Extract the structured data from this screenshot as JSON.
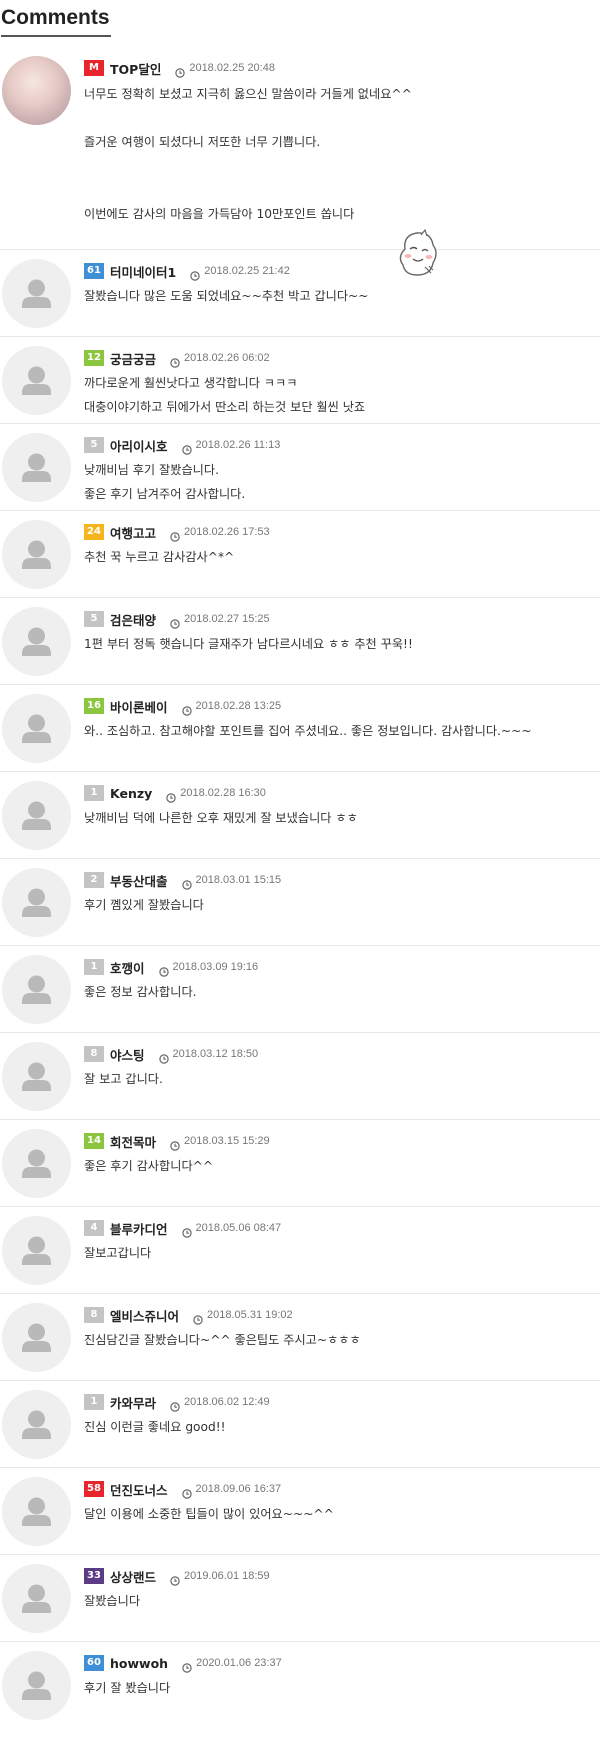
{
  "section_title": "Comments",
  "colors": {
    "M": "#e8252d",
    "blue": "#3f8fd6",
    "green": "#8cc63f",
    "gray": "#c4c4c4",
    "yellow": "#f5b51b",
    "red": "#e8252d",
    "purple": "#5b3a86"
  },
  "comments": [
    {
      "level": "M",
      "level_color": "M",
      "nick": "TOP달인",
      "date": "2018.02.25 20:48",
      "avatar": "photo",
      "lines": [
        "너무도 정확히 보셨고 지극히 옳으신 말씀이라 거들게 없네요^^",
        "",
        "즐거운 여행이 되셨다니 저또한 너무 기쁩니다.",
        "",
        "",
        "이번에도 감사의 마음을 가득담아 10만포인트 쏩니다"
      ]
    },
    {
      "level": "61",
      "level_color": "blue",
      "nick": "터미네이터1",
      "date": "2018.02.25 21:42",
      "lines": [
        "잘봤습니다 많은 도움 되었네요~~추천 박고 갑니다~~"
      ]
    },
    {
      "level": "12",
      "level_color": "green",
      "nick": "궁금궁금",
      "date": "2018.02.26 06:02",
      "lines": [
        "까다로운게 훨씬낫다고 생각합니다 ㅋㅋㅋ",
        "대충이야기하고 뒤에가서 딴소리 하는것 보단 훨씬 낫죠"
      ]
    },
    {
      "level": "5",
      "level_color": "gray",
      "nick": "아리이시호",
      "date": "2018.02.26 11:13",
      "lines": [
        "낮깨비님 후기 잘봤습니다.",
        "좋은 후기 남겨주어 감사합니다."
      ]
    },
    {
      "level": "24",
      "level_color": "yellow",
      "nick": "여행고고",
      "date": "2018.02.26 17:53",
      "lines": [
        "추천 꾹 누르고 감사감사^*^"
      ]
    },
    {
      "level": "5",
      "level_color": "gray",
      "nick": "검은태양",
      "date": "2018.02.27 15:25",
      "lines": [
        "1편 부터 정독 햇습니다 글재주가 남다르시네요 ㅎㅎ 추천 꾸욱!!"
      ]
    },
    {
      "level": "16",
      "level_color": "green",
      "nick": "바이론베이",
      "date": "2018.02.28 13:25",
      "lines": [
        "와.. 조심하고. 참고해야할 포인트를 집어 주셨네요.. 좋은 정보입니다. 감사합니다.~~~"
      ]
    },
    {
      "level": "1",
      "level_color": "gray",
      "nick": "Kenzy",
      "date": "2018.02.28 16:30",
      "lines": [
        "낮깨비님 덕에 나른한 오후 재밌게 잘 보냈습니다 ㅎㅎ"
      ]
    },
    {
      "level": "2",
      "level_color": "gray",
      "nick": "부동산대출",
      "date": "2018.03.01 15:15",
      "lines": [
        "후기 꼠있게 잘봤습니다"
      ]
    },
    {
      "level": "1",
      "level_color": "gray",
      "nick": "호깽이",
      "date": "2018.03.09 19:16",
      "lines": [
        "좋은 정보 감사합니다."
      ]
    },
    {
      "level": "8",
      "level_color": "gray",
      "nick": "야스팅",
      "date": "2018.03.12 18:50",
      "lines": [
        "잘 보고   갑니다."
      ]
    },
    {
      "level": "14",
      "level_color": "green",
      "nick": "회전목마",
      "date": "2018.03.15 15:29",
      "lines": [
        "좋은 후기 감사합니다^^"
      ]
    },
    {
      "level": "4",
      "level_color": "gray",
      "nick": "블루카디언",
      "date": "2018.05.06 08:47",
      "lines": [
        "잘보고갑니다"
      ]
    },
    {
      "level": "8",
      "level_color": "gray",
      "nick": "엘비스쥬니어",
      "date": "2018.05.31 19:02",
      "lines": [
        "진심담긴글 잘봤습니다~^^ 좋은팁도 주시고~ㅎㅎㅎ"
      ]
    },
    {
      "level": "1",
      "level_color": "gray",
      "nick": "카와무라",
      "date": "2018.06.02 12:49",
      "lines": [
        "진심 이런글 좋네요 good!!"
      ]
    },
    {
      "level": "58",
      "level_color": "red",
      "nick": "던진도너스",
      "date": "2018.09.06 16:37",
      "lines": [
        "달인 이용에 소중한 팁들이 많이 있어요~~~^^"
      ]
    },
    {
      "level": "33",
      "level_color": "purple",
      "nick": "상상랜드",
      "date": "2019.06.01 18:59",
      "lines": [
        "잘봤습니다"
      ]
    },
    {
      "level": "60",
      "level_color": "blue",
      "nick": "howwoh",
      "date": "2020.01.06 23:37",
      "lines": [
        "후기 잘 봤습니다"
      ]
    }
  ]
}
